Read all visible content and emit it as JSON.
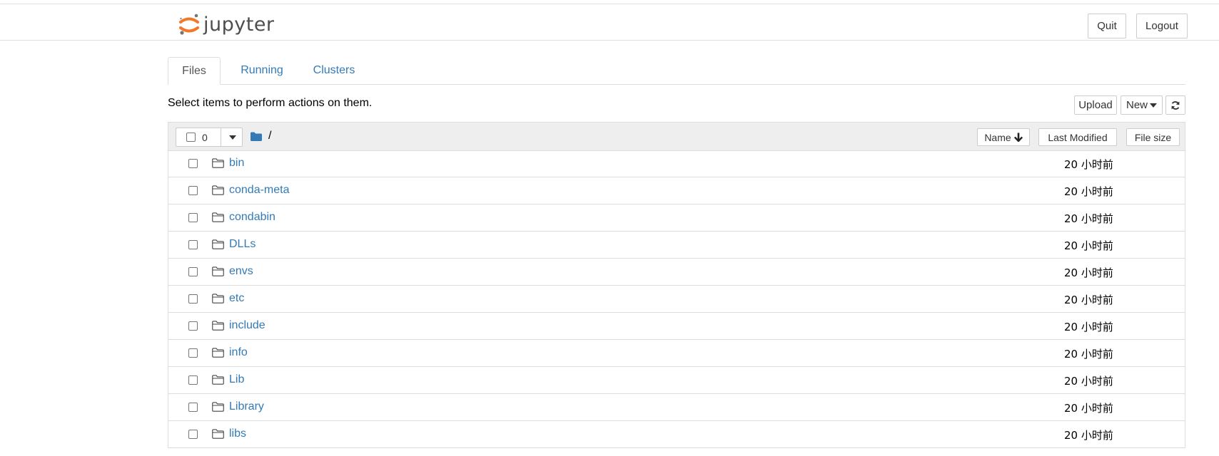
{
  "header": {
    "logo_text": "jupyter",
    "quit_label": "Quit",
    "logout_label": "Logout"
  },
  "tabs": [
    {
      "label": "Files",
      "active": true
    },
    {
      "label": "Running",
      "active": false
    },
    {
      "label": "Clusters",
      "active": false
    }
  ],
  "toolbar": {
    "hint": "Select items to perform actions on them.",
    "upload_label": "Upload",
    "new_label": "New",
    "refresh_icon": "refresh-icon"
  },
  "list_header": {
    "selected_count": "0",
    "path": "/",
    "sort_name_label": "Name",
    "sort_modified_label": "Last Modified",
    "sort_size_label": "File size"
  },
  "files": [
    {
      "name": "bin",
      "modified": "20 小时前"
    },
    {
      "name": "conda-meta",
      "modified": "20 小时前"
    },
    {
      "name": "condabin",
      "modified": "20 小时前"
    },
    {
      "name": "DLLs",
      "modified": "20 小时前"
    },
    {
      "name": "envs",
      "modified": "20 小时前"
    },
    {
      "name": "etc",
      "modified": "20 小时前"
    },
    {
      "name": "include",
      "modified": "20 小时前"
    },
    {
      "name": "info",
      "modified": "20 小时前"
    },
    {
      "name": "Lib",
      "modified": "20 小时前"
    },
    {
      "name": "Library",
      "modified": "20 小时前"
    },
    {
      "name": "libs",
      "modified": "20 小时前"
    }
  ],
  "colors": {
    "link": "#337ab7",
    "logo_orange": "#f37726",
    "header_bg": "#eeeeee",
    "border": "#dddddd"
  }
}
